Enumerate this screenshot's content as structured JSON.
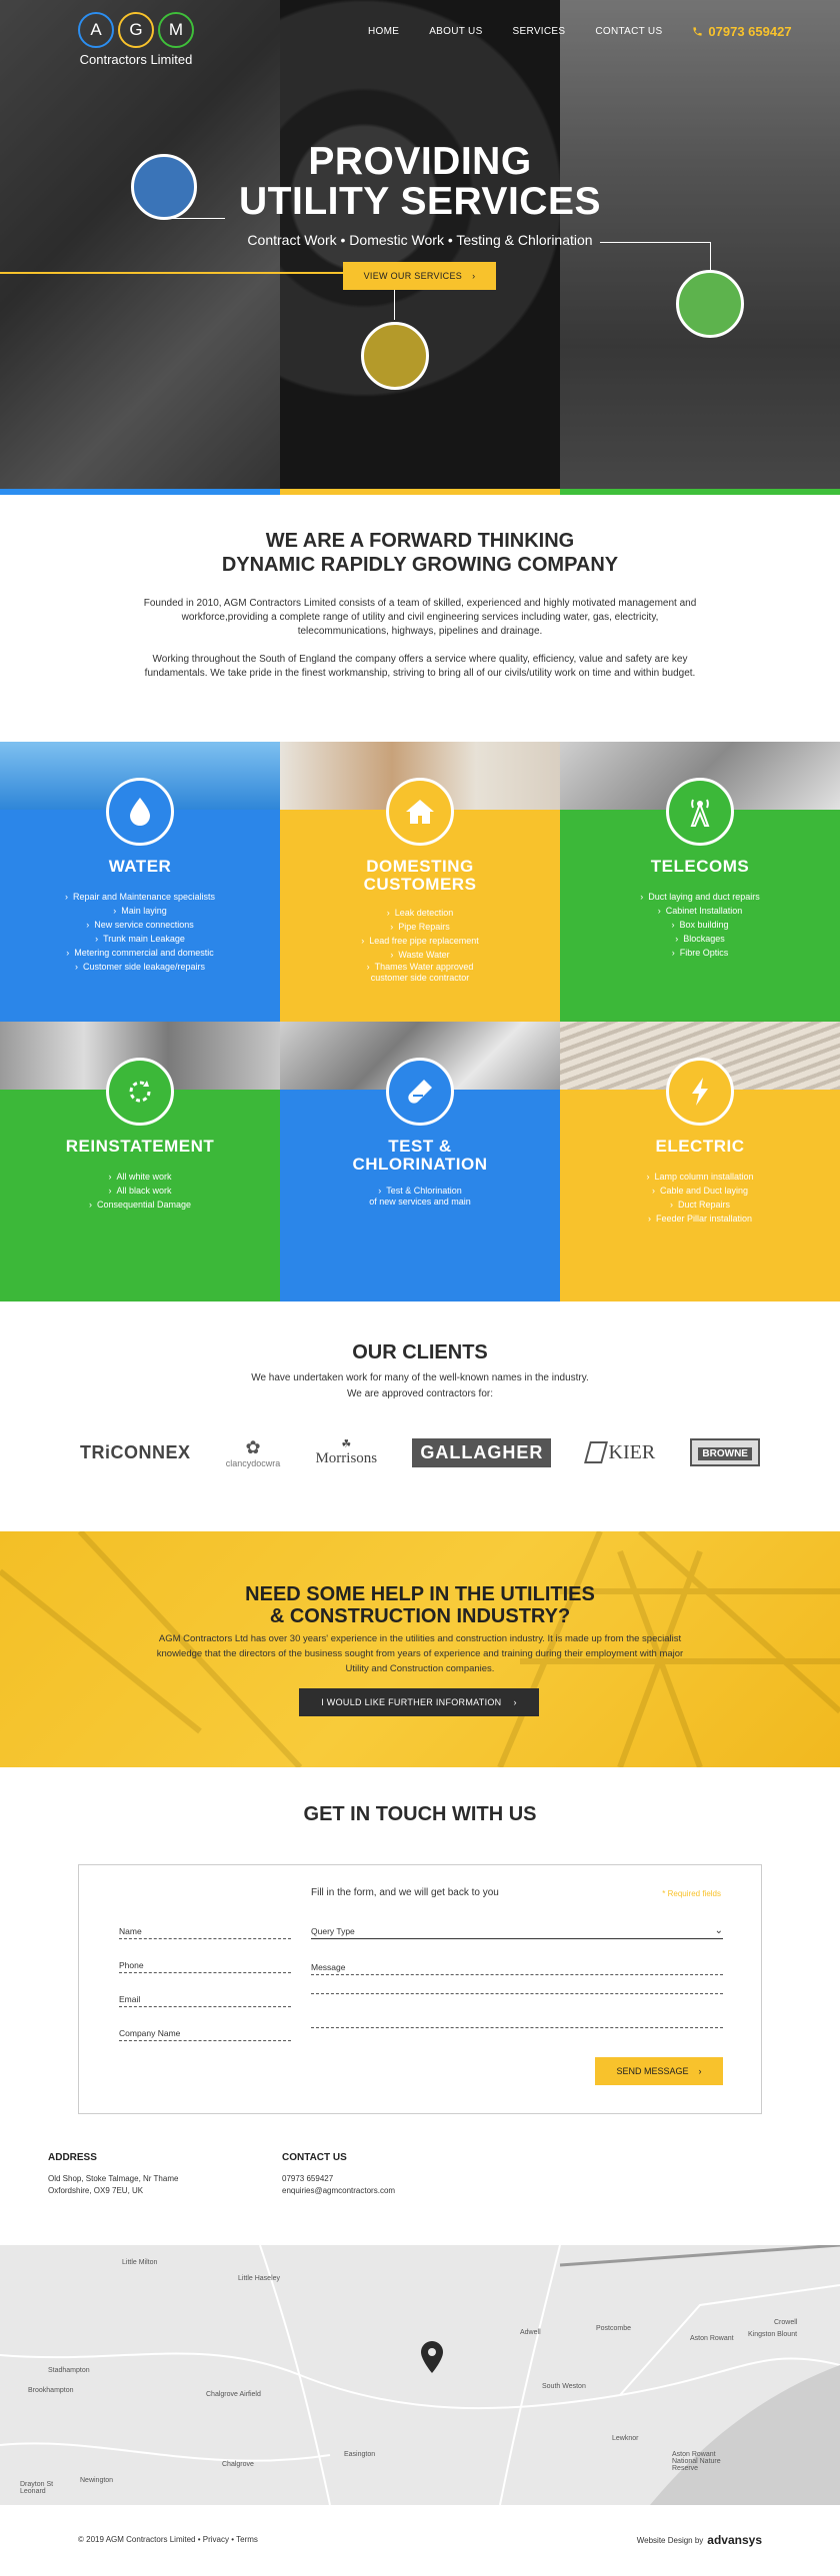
{
  "header": {
    "logo_letters": [
      "A",
      "G",
      "M"
    ],
    "logo_sub": "Contractors Limited",
    "nav": [
      "HOME",
      "ABOUT US",
      "SERVICES",
      "CONTACT US"
    ],
    "phone": "07973 659427",
    "colors": {
      "blue": "#2b86e9",
      "yellow": "#f8c22c",
      "green": "#3cb839"
    }
  },
  "hero": {
    "title_1": "PROVIDING",
    "title_2": "UTILITY SERVICES",
    "subtitle": "Contract Work  •  Domestic Work  •  Testing & Chlorination",
    "button": "VIEW OUR SERVICES"
  },
  "intro": {
    "heading_1": "WE ARE A FORWARD THINKING",
    "heading_2": "DYNAMIC RAPIDLY GROWING COMPANY",
    "para_1": "Founded in 2010, AGM Contractors Limited consists of a team of skilled, experienced and highly motivated management and workforce,providing a complete range of utility and civil engineering services including water, gas, electricity, telecommunications, highways, pipelines and drainage.",
    "para_2": "Working throughout the South of England the company offers a service where quality, efficiency, value and safety are key fundamentals.  We take pride in the finest workmanship, striving to bring all of our civils/utility work on time and within budget."
  },
  "services": [
    {
      "title": "WATER",
      "icon": "water-drop-icon",
      "items": [
        "Repair and Maintenance specialists",
        "Main laying",
        "New service connections",
        "Trunk main Leakage",
        "Metering commercial and domestic",
        "Customer side leakage/repairs"
      ]
    },
    {
      "title": "DOMESTING CUSTOMERS",
      "icon": "house-icon",
      "items": [
        "Leak detection",
        "Pipe Repairs",
        "Lead free pipe replacement",
        "Waste Water",
        "Thames Water approved"
      ],
      "extra": "customer side contractor"
    },
    {
      "title": "TELECOMS",
      "icon": "mast-icon",
      "items": [
        "Duct laying and duct repairs",
        "Cabinet Installation",
        "Box building",
        "Blockages",
        "Fibre Optics"
      ]
    },
    {
      "title": "REINSTATEMENT",
      "icon": "refresh-icon",
      "items": [
        "All white work",
        "All black work",
        "Consequential Damage"
      ]
    },
    {
      "title": "TEST & CHLORINATION",
      "icon": "test-tube-icon",
      "items": [
        "Test & Chlorination"
      ],
      "extra": "of new services and main"
    },
    {
      "title": "ELECTRIC",
      "icon": "lightning-icon",
      "items": [
        "Lamp column installation",
        "Cable and Duct laying",
        "Duct Repairs",
        "Feeder Pillar installation"
      ]
    }
  ],
  "clients": {
    "heading": "OUR CLIENTS",
    "line_1": "We have undertaken work for many of the well-known names in the industry.",
    "line_2": "We are approved contractors for:",
    "logos": [
      "TRiCONNEX",
      "clancydocwra",
      "Morrisons",
      "GALLAGHER",
      "KIER",
      "BROWNE"
    ]
  },
  "help": {
    "heading_1": "NEED SOME HELP IN THE UTILITIES",
    "heading_2": "& CONSTRUCTION INDUSTRY?",
    "text": "AGM Contractors Ltd has over 30 years' experience in the utilities and construction industry. It is made up from the specialist knowledge that the directors of the business sought from years of experience and training during their employment with major Utility and Construction companies.",
    "button": "I WOULD LIKE FURTHER INFORMATION"
  },
  "contact": {
    "heading": "GET IN TOUCH WITH US",
    "form_intro": "Fill in the form, and we will get back to you",
    "required_note": "* Required fields",
    "fields": {
      "name": "Name",
      "phone": "Phone",
      "email": "Email",
      "company": "Company Name",
      "query": "Query Type",
      "message": "Message"
    },
    "send": "SEND MESSAGE",
    "address_label": "ADDRESS",
    "address_1": "Old Shop, Stoke Talmage, Nr Thame",
    "address_2": "Oxfordshire, OX9 7EU, UK",
    "contact_label": "CONTACT US",
    "contact_phone": "07973 659427",
    "contact_email": "enquiries@agmcontractors.com"
  },
  "map": {
    "places": [
      "Little Milton",
      "Little Haseley",
      "Adwell",
      "Postcombe",
      "Aston Rowant",
      "Kingston Blount",
      "Crowell",
      "Stadhampton",
      "Brookhampton",
      "Chalgrove Airfield",
      "South Weston",
      "Easington",
      "Chalgrove",
      "Lewknor",
      "Newington",
      "Drayton St Leonard",
      "Aston Rowant National Nature Reserve"
    ]
  },
  "footer": {
    "copyright": "© 2019 AGM Contractors Limited",
    "privacy": "Privacy",
    "terms": "Terms",
    "credit": "Website Design by",
    "brand": "advansys"
  }
}
